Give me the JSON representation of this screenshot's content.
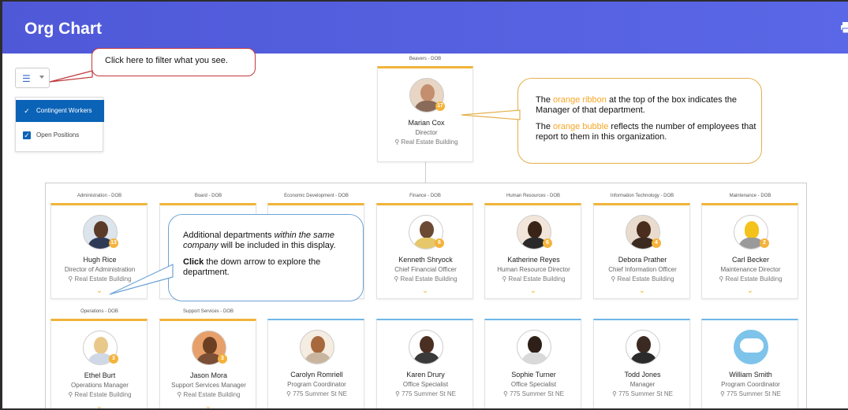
{
  "header": {
    "title": "Org Chart"
  },
  "filter": {
    "options": [
      "Contingent Workers",
      "Open Positions"
    ]
  },
  "callouts": {
    "filter_tip": "Click here to filter what you see.",
    "ribbon_1": "The ",
    "ribbon_hl": "orange ribbon",
    "ribbon_2": " at the top of the box indicates the Manager of that department.",
    "bubble_1": "The ",
    "bubble_hl": "orange bubble",
    "bubble_2": " reflects the number of employees that report to them in this organization.",
    "dept_1": "Additional departments ",
    "dept_em": "within the same company",
    "dept_2": " will be included in this display.",
    "click_strong": "Click",
    "click_rest": " the down arrow to explore the department."
  },
  "top": {
    "dept": "Beavers - DOB",
    "name": "Marian Cox",
    "role": "Director",
    "loc": "Real Estate Building",
    "count": "17"
  },
  "row1": [
    {
      "dept": "Administration - DOB",
      "name": "Hugh Rice",
      "role": "Director of Administration",
      "loc": "Real Estate Building",
      "count": "13"
    },
    {
      "dept": "Board - DOB"
    },
    {
      "dept": "Economic Development - DOB"
    },
    {
      "dept": "Finance - DOB",
      "name": "Kenneth Shryock",
      "role": "Chief Financial Officer",
      "loc": "Real Estate Building",
      "count": "6"
    },
    {
      "dept": "Human Resources - DOB",
      "name": "Katherine Reyes",
      "role": "Human Resource Director",
      "loc": "Real Estate Building",
      "count": "6"
    },
    {
      "dept": "Information Technology - DOB",
      "name": "Debora Prather",
      "role": "Chief Information Officer",
      "loc": "Real Estate Building",
      "count": "4"
    },
    {
      "dept": "Maintenance - DOB",
      "name": "Carl Becker",
      "role": "Maintenance Director",
      "loc": "Real Estate Building",
      "count": "2"
    }
  ],
  "row2": [
    {
      "dept": "Operations - DOB",
      "name": "Ethel Burt",
      "role": "Operations Manager",
      "loc": "Real Estate Building",
      "count": "3"
    },
    {
      "dept": "Support Services - DOB",
      "name": "Jason Mora",
      "role": "Support Services Manager",
      "loc": "Real Estate Building",
      "count": "3"
    },
    {
      "name": "Carolyn Romriell",
      "role": "Program Coordinator",
      "loc": "775 Summer St NE"
    },
    {
      "name": "Karen Drury",
      "role": "Office Specialist",
      "loc": "775 Summer St NE"
    },
    {
      "name": "Sophie Turner",
      "role": "Office Specialist",
      "loc": "775 Summer St NE"
    },
    {
      "name": "Todd Jones",
      "role": "Manager",
      "loc": "775 Summer St NE"
    },
    {
      "name": "William Smith",
      "role": "Program Coordinator",
      "loc": "775 Summer St NE"
    }
  ],
  "colors": {
    "header": "#5560e0",
    "manager_ribbon": "#f0b43a",
    "employee_ribbon": "#6fb6e6",
    "badge": "#f4b33b",
    "filter_selected": "#0b63b7"
  },
  "icons": {
    "print": "print-icon",
    "filter": "filter-list-icon",
    "location": "location-pin-icon",
    "expand": "chevron-down-icon"
  }
}
